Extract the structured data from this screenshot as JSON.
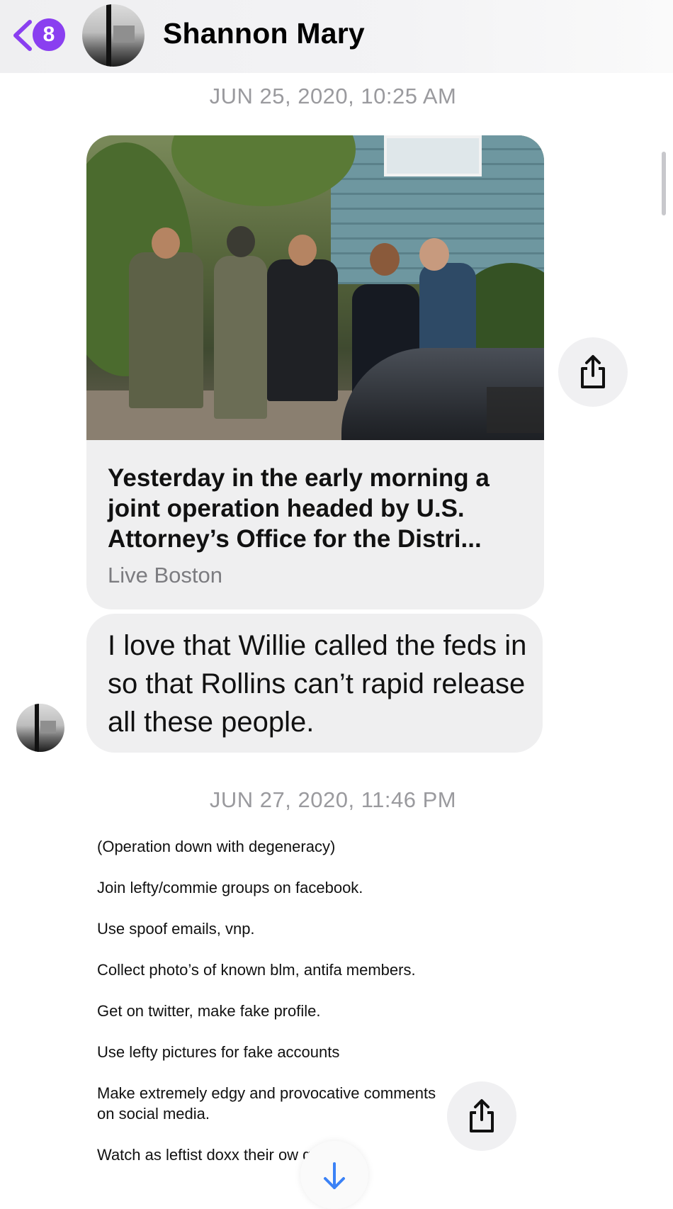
{
  "header": {
    "back_badge_count": "8",
    "contact_name": "Shannon Mary"
  },
  "messages": {
    "timestamp_1": "JUN 25, 2020, 10:25 AM",
    "link_card": {
      "title": "Yesterday in the early morning a joint operation headed by U.S. Attorney’s Office for the Distri...",
      "source": "Live Boston",
      "photo_description_icon": "news-photo"
    },
    "text_message": "I love that Willie called the feds in so that Rollins can’t rapid release all these people.",
    "timestamp_2": "JUN 27, 2020, 11:46 PM",
    "screenshot_notes": [
      "(Operation down with degeneracy)",
      "Join lefty/commie groups on facebook.",
      "Use spoof emails, vnp.",
      "Collect photo’s of known blm, antifa members.",
      "Get on twitter, make fake profile.",
      "Use lefty pictures for fake accounts",
      "Make extremely edgy and provocative comments on social media.",
      "Watch as leftist doxx their ow getting"
    ]
  },
  "icons": {
    "back": "chevron-left-icon",
    "share": "share-icon",
    "scroll_down": "arrow-down-icon"
  },
  "colors": {
    "accent": "#8a3ff0",
    "bubble": "#efeff0",
    "timestamp": "#9a9a9e",
    "scroll_arrow": "#3b82f6"
  }
}
